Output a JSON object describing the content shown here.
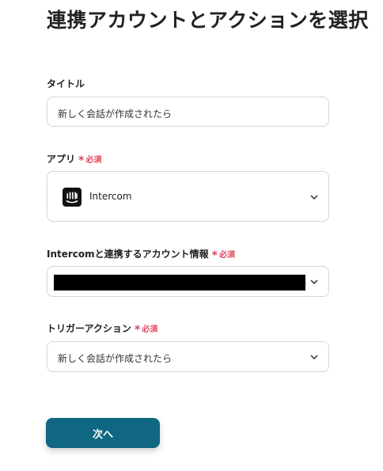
{
  "page": {
    "title": "連携アカウントとアクションを選択"
  },
  "form": {
    "title_field": {
      "label": "タイトル",
      "value": "新しく会話が作成されたら"
    },
    "app_field": {
      "label": "アプリ",
      "required_text": "必須",
      "value": "Intercom",
      "icon": "intercom-icon"
    },
    "account_field": {
      "label": "Intercomと連携するアカウント情報",
      "required_text": "必須",
      "value_redacted": true
    },
    "trigger_field": {
      "label": "トリガーアクション",
      "required_text": "必須",
      "value": "新しく会話が作成されたら"
    }
  },
  "actions": {
    "next_label": "次へ"
  },
  "colors": {
    "required": "#e0455e",
    "primary_button": "#0f6781",
    "field_border": "#d3d6da"
  }
}
